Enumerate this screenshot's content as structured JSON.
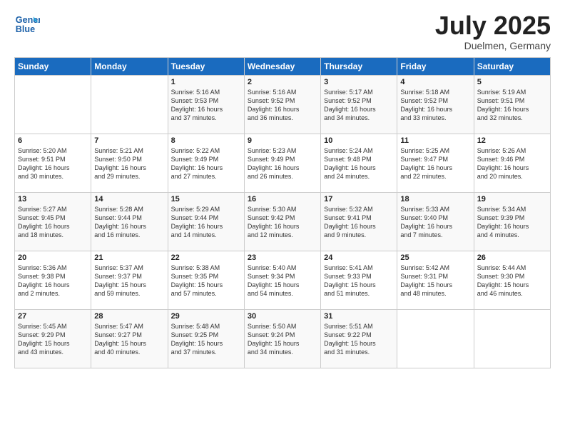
{
  "logo": {
    "line1": "General",
    "line2": "Blue"
  },
  "title": "July 2025",
  "location": "Duelmen, Germany",
  "days_of_week": [
    "Sunday",
    "Monday",
    "Tuesday",
    "Wednesday",
    "Thursday",
    "Friday",
    "Saturday"
  ],
  "weeks": [
    [
      {
        "day": "",
        "content": ""
      },
      {
        "day": "",
        "content": ""
      },
      {
        "day": "1",
        "content": "Sunrise: 5:16 AM\nSunset: 9:53 PM\nDaylight: 16 hours\nand 37 minutes."
      },
      {
        "day": "2",
        "content": "Sunrise: 5:16 AM\nSunset: 9:52 PM\nDaylight: 16 hours\nand 36 minutes."
      },
      {
        "day": "3",
        "content": "Sunrise: 5:17 AM\nSunset: 9:52 PM\nDaylight: 16 hours\nand 34 minutes."
      },
      {
        "day": "4",
        "content": "Sunrise: 5:18 AM\nSunset: 9:52 PM\nDaylight: 16 hours\nand 33 minutes."
      },
      {
        "day": "5",
        "content": "Sunrise: 5:19 AM\nSunset: 9:51 PM\nDaylight: 16 hours\nand 32 minutes."
      }
    ],
    [
      {
        "day": "6",
        "content": "Sunrise: 5:20 AM\nSunset: 9:51 PM\nDaylight: 16 hours\nand 30 minutes."
      },
      {
        "day": "7",
        "content": "Sunrise: 5:21 AM\nSunset: 9:50 PM\nDaylight: 16 hours\nand 29 minutes."
      },
      {
        "day": "8",
        "content": "Sunrise: 5:22 AM\nSunset: 9:49 PM\nDaylight: 16 hours\nand 27 minutes."
      },
      {
        "day": "9",
        "content": "Sunrise: 5:23 AM\nSunset: 9:49 PM\nDaylight: 16 hours\nand 26 minutes."
      },
      {
        "day": "10",
        "content": "Sunrise: 5:24 AM\nSunset: 9:48 PM\nDaylight: 16 hours\nand 24 minutes."
      },
      {
        "day": "11",
        "content": "Sunrise: 5:25 AM\nSunset: 9:47 PM\nDaylight: 16 hours\nand 22 minutes."
      },
      {
        "day": "12",
        "content": "Sunrise: 5:26 AM\nSunset: 9:46 PM\nDaylight: 16 hours\nand 20 minutes."
      }
    ],
    [
      {
        "day": "13",
        "content": "Sunrise: 5:27 AM\nSunset: 9:45 PM\nDaylight: 16 hours\nand 18 minutes."
      },
      {
        "day": "14",
        "content": "Sunrise: 5:28 AM\nSunset: 9:44 PM\nDaylight: 16 hours\nand 16 minutes."
      },
      {
        "day": "15",
        "content": "Sunrise: 5:29 AM\nSunset: 9:44 PM\nDaylight: 16 hours\nand 14 minutes."
      },
      {
        "day": "16",
        "content": "Sunrise: 5:30 AM\nSunset: 9:42 PM\nDaylight: 16 hours\nand 12 minutes."
      },
      {
        "day": "17",
        "content": "Sunrise: 5:32 AM\nSunset: 9:41 PM\nDaylight: 16 hours\nand 9 minutes."
      },
      {
        "day": "18",
        "content": "Sunrise: 5:33 AM\nSunset: 9:40 PM\nDaylight: 16 hours\nand 7 minutes."
      },
      {
        "day": "19",
        "content": "Sunrise: 5:34 AM\nSunset: 9:39 PM\nDaylight: 16 hours\nand 4 minutes."
      }
    ],
    [
      {
        "day": "20",
        "content": "Sunrise: 5:36 AM\nSunset: 9:38 PM\nDaylight: 16 hours\nand 2 minutes."
      },
      {
        "day": "21",
        "content": "Sunrise: 5:37 AM\nSunset: 9:37 PM\nDaylight: 15 hours\nand 59 minutes."
      },
      {
        "day": "22",
        "content": "Sunrise: 5:38 AM\nSunset: 9:35 PM\nDaylight: 15 hours\nand 57 minutes."
      },
      {
        "day": "23",
        "content": "Sunrise: 5:40 AM\nSunset: 9:34 PM\nDaylight: 15 hours\nand 54 minutes."
      },
      {
        "day": "24",
        "content": "Sunrise: 5:41 AM\nSunset: 9:33 PM\nDaylight: 15 hours\nand 51 minutes."
      },
      {
        "day": "25",
        "content": "Sunrise: 5:42 AM\nSunset: 9:31 PM\nDaylight: 15 hours\nand 48 minutes."
      },
      {
        "day": "26",
        "content": "Sunrise: 5:44 AM\nSunset: 9:30 PM\nDaylight: 15 hours\nand 46 minutes."
      }
    ],
    [
      {
        "day": "27",
        "content": "Sunrise: 5:45 AM\nSunset: 9:29 PM\nDaylight: 15 hours\nand 43 minutes."
      },
      {
        "day": "28",
        "content": "Sunrise: 5:47 AM\nSunset: 9:27 PM\nDaylight: 15 hours\nand 40 minutes."
      },
      {
        "day": "29",
        "content": "Sunrise: 5:48 AM\nSunset: 9:25 PM\nDaylight: 15 hours\nand 37 minutes."
      },
      {
        "day": "30",
        "content": "Sunrise: 5:50 AM\nSunset: 9:24 PM\nDaylight: 15 hours\nand 34 minutes."
      },
      {
        "day": "31",
        "content": "Sunrise: 5:51 AM\nSunset: 9:22 PM\nDaylight: 15 hours\nand 31 minutes."
      },
      {
        "day": "",
        "content": ""
      },
      {
        "day": "",
        "content": ""
      }
    ]
  ]
}
